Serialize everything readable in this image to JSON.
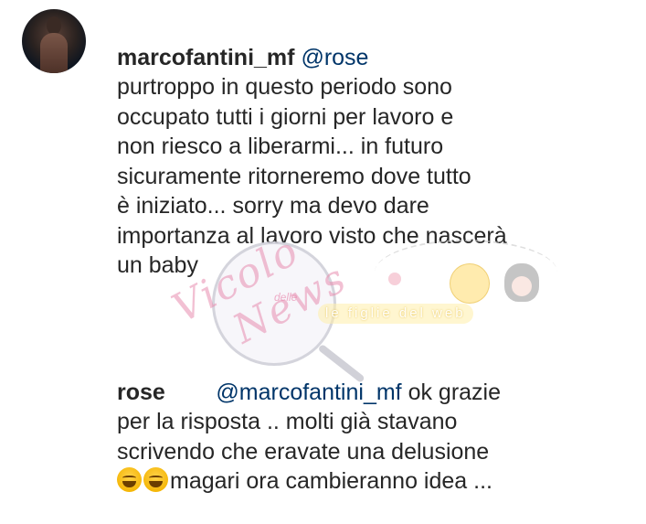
{
  "comments": [
    {
      "username": "marcofantini_mf",
      "mention": "@rose",
      "lines": [
        "purtroppo in questo periodo sono",
        "occupato tutti i giorni per lavoro e",
        "non riesco a liberarmi... in futuro",
        "sicuramente ritorneremo dove tutto",
        "è iniziato... sorry ma devo dare",
        "importanza al lavoro visto che nascerà",
        "un baby"
      ]
    },
    {
      "username": "rose",
      "mention": "@marcofantini_mf",
      "first_line_rest": " ok grazie",
      "lines": [
        "per la risposta .. molti già stavano",
        "scrivendo che eravate una delusione"
      ],
      "last_line_text": "magari ora cambieranno idea ...",
      "emojis": [
        "face-with-tears-of-joy",
        "face-with-tears-of-joy"
      ]
    }
  ],
  "watermark": {
    "logo_text_1": "Vicolo",
    "logo_small": "delle",
    "logo_text_2": "News",
    "banner": "le figlie del web"
  }
}
